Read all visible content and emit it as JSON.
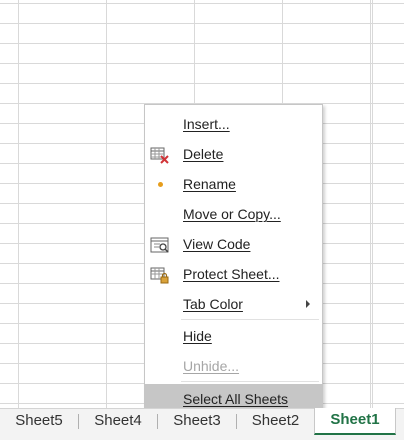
{
  "menu": {
    "items": [
      {
        "label": "Insert...",
        "icon": "none",
        "enabled": true
      },
      {
        "label": "Delete",
        "icon": "delete-sheet-icon",
        "enabled": true
      },
      {
        "label": "Rename",
        "icon": "orange-dot-icon",
        "enabled": true
      },
      {
        "label": "Move or Copy...",
        "icon": "none",
        "enabled": true
      },
      {
        "label": "View Code",
        "icon": "view-code-icon",
        "enabled": true
      },
      {
        "label": "Protect Sheet...",
        "icon": "protect-sheet-icon",
        "enabled": true
      },
      {
        "label": "Tab Color",
        "icon": "none",
        "enabled": true,
        "has_submenu": true
      },
      {
        "label": "Hide",
        "icon": "none",
        "enabled": true
      },
      {
        "label": "Unhide...",
        "icon": "none",
        "enabled": false
      },
      {
        "label": "Select All Sheets",
        "icon": "none",
        "enabled": true,
        "highlighted": true
      }
    ]
  },
  "tabs": [
    {
      "label": "Sheet5",
      "active": false
    },
    {
      "label": "Sheet4",
      "active": false
    },
    {
      "label": "Sheet3",
      "active": false
    },
    {
      "label": "Sheet2",
      "active": false
    },
    {
      "label": "Sheet1",
      "active": true
    }
  ],
  "colors": {
    "accent_green": "#217346",
    "highlight": "#c6c6c6",
    "delete_x": "#d13438"
  }
}
